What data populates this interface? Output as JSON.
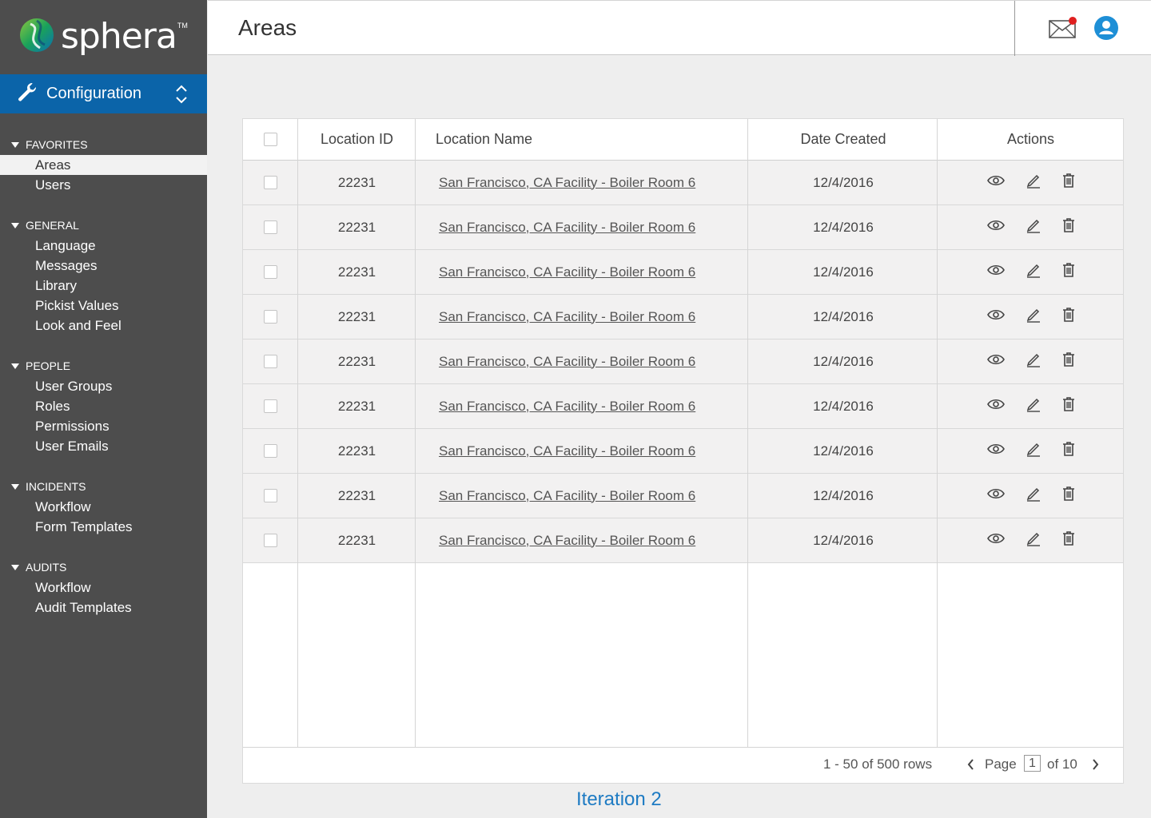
{
  "brand": {
    "name": "sphera",
    "trademark": "TM"
  },
  "config": {
    "label": "Configuration"
  },
  "nav": {
    "sections": [
      {
        "title": "FAVORITES",
        "items": [
          "Areas",
          "Users"
        ]
      },
      {
        "title": "GENERAL",
        "items": [
          "Language",
          "Messages",
          "Library",
          "Pickist Values",
          "Look and Feel"
        ]
      },
      {
        "title": "PEOPLE",
        "items": [
          "User Groups",
          "Roles",
          "Permissions",
          "User Emails"
        ]
      },
      {
        "title": "INCIDENTS",
        "items": [
          "Workflow",
          "Form Templates"
        ]
      },
      {
        "title": "AUDITS",
        "items": [
          "Workflow",
          "Audit Templates"
        ]
      }
    ],
    "active_item": "Areas"
  },
  "header": {
    "title": "Areas",
    "mail_has_notification": true
  },
  "table": {
    "columns": [
      "Location ID",
      "Location Name",
      "Date Created",
      "Actions"
    ],
    "rows": [
      {
        "id": "22231",
        "name": "San Francisco, CA Facility - Boiler Room 6",
        "date": "12/4/2016"
      },
      {
        "id": "22231",
        "name": "San Francisco, CA Facility - Boiler Room 6",
        "date": "12/4/2016"
      },
      {
        "id": "22231",
        "name": "San Francisco, CA Facility - Boiler Room 6",
        "date": "12/4/2016"
      },
      {
        "id": "22231",
        "name": "San Francisco, CA Facility - Boiler Room 6",
        "date": "12/4/2016"
      },
      {
        "id": "22231",
        "name": "San Francisco, CA Facility - Boiler Room 6",
        "date": "12/4/2016"
      },
      {
        "id": "22231",
        "name": "San Francisco, CA Facility - Boiler Room 6",
        "date": "12/4/2016"
      },
      {
        "id": "22231",
        "name": "San Francisco, CA Facility - Boiler Room 6",
        "date": "12/4/2016"
      },
      {
        "id": "22231",
        "name": "San Francisco, CA Facility - Boiler Room 6",
        "date": "12/4/2016"
      },
      {
        "id": "22231",
        "name": "San Francisco, CA Facility - Boiler Room 6",
        "date": "12/4/2016"
      }
    ],
    "actions": [
      "view-icon",
      "edit-icon",
      "delete-icon"
    ]
  },
  "pagination": {
    "rows_info": "1 - 50 of 500 rows",
    "page_label": "Page",
    "current_page": "1",
    "of_label": "of 10"
  },
  "annotation": "Iteration 2",
  "colors": {
    "sidebar": "#4d4d4d",
    "config_bar": "#0b64a9",
    "notification_dot": "#e02020",
    "user_icon": "#1e8fd6",
    "annotation": "#1e7bc3"
  }
}
